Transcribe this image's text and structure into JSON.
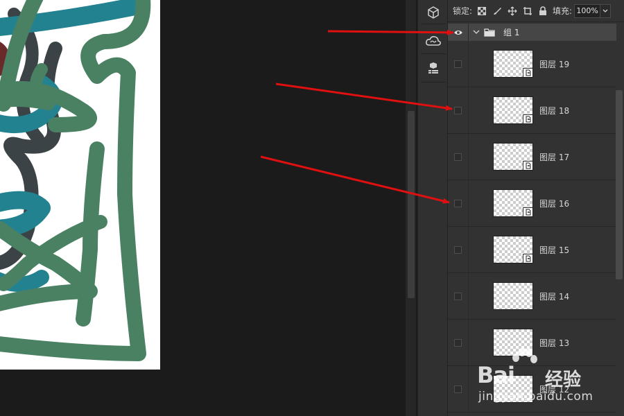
{
  "toolbar": {
    "lock_label": "锁定:",
    "fill_label": "填充:",
    "fill_value": "100%",
    "icons": [
      "lock-transparent-pixels-icon",
      "lock-image-pixels-icon",
      "lock-position-icon",
      "lock-artboard-icon",
      "lock-all-icon"
    ]
  },
  "icon_strip": {
    "icons": [
      "3d-cube-icon",
      "creative-cloud-libraries-icon",
      "3d-scene-icon"
    ]
  },
  "layers_panel": {
    "group": {
      "name": "组 1",
      "visible": true,
      "expanded": true
    },
    "layers": [
      {
        "name": "图层 19",
        "smart_object": true
      },
      {
        "name": "图层 18",
        "smart_object": true
      },
      {
        "name": "图层 17",
        "smart_object": true
      },
      {
        "name": "图层 16",
        "smart_object": true
      },
      {
        "name": "图层 15",
        "smart_object": true
      },
      {
        "name": "图层 14",
        "smart_object": false
      },
      {
        "name": "图层 13",
        "smart_object": false
      },
      {
        "name": "图层 12",
        "smart_object": false
      }
    ]
  },
  "annotation": {
    "arrow_color": "#e01010"
  },
  "colors": {
    "stroke_green": "#4a8163",
    "stroke_teal": "#23828f",
    "stroke_slate": "#3b4347",
    "stroke_maroon": "#6b2a2a",
    "canvas_bg": "#ffffff",
    "workspace_bg": "#1b1b1b",
    "panel_bg": "#323232"
  },
  "watermark": {
    "brand": "Bai",
    "brand_cn": "经验",
    "url": "jingyan.baidu.com"
  }
}
